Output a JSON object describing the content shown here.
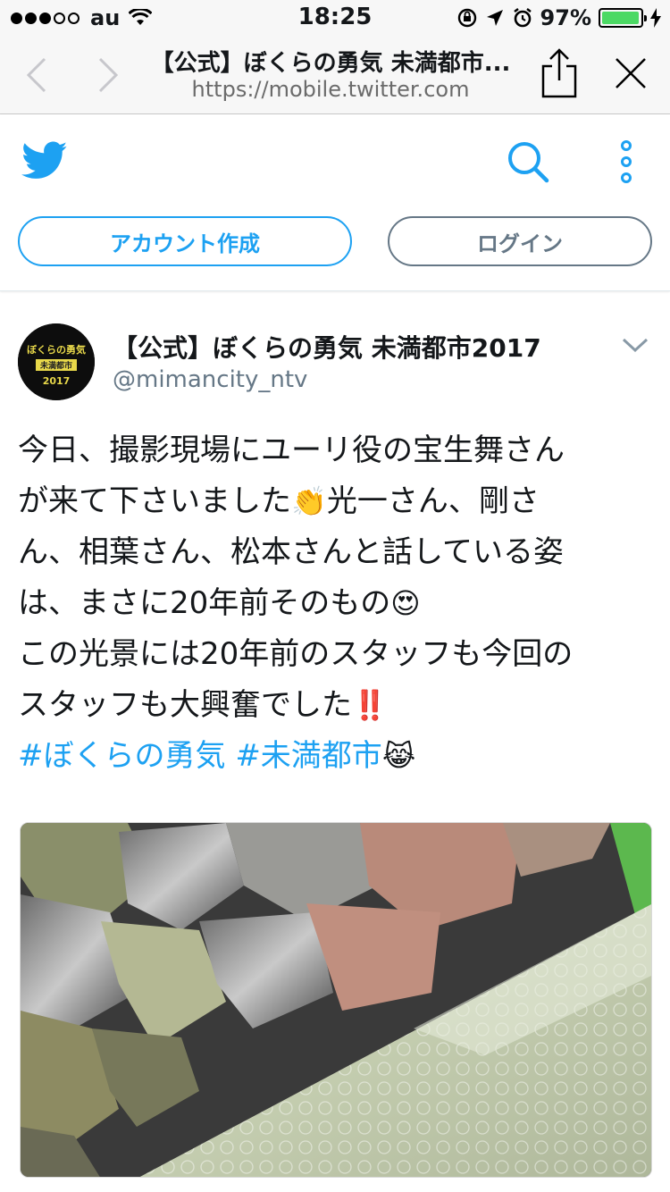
{
  "status_bar": {
    "carrier": "au",
    "time": "18:25",
    "battery_percent": "97%",
    "battery_level": 0.97
  },
  "browser": {
    "title": "【公式】ぼくらの勇気 未満都市...",
    "url": "https://mobile.twitter.com"
  },
  "header": {
    "signup_label": "アカウント作成",
    "login_label": "ログイン"
  },
  "tweet": {
    "display_name": "【公式】ぼくらの勇気 未満都市2017",
    "handle": "@mimancity_ntv",
    "avatar_text": [
      "ぼくらの勇気",
      "未満都市",
      "2017"
    ],
    "lines": [
      "今日、撮影現場にユーリ役の宝生舞さん",
      "が来て下さいました",
      "光一さん、剛さ",
      "ん、相葉さん、松本さんと話している姿",
      "は、まさに20年前そのもの",
      "この光景には20年前のスタッフも今回の",
      "スタッフも大興奮でした"
    ],
    "hashtags": [
      "#ぼくらの勇気",
      "#未満都市"
    ],
    "emoji": {
      "clap": "👏",
      "heart_eyes": "😍",
      "exclamation": "‼️",
      "cat": "😹"
    }
  },
  "colors": {
    "twitter_blue": "#1da1f2",
    "grey_text": "#657786",
    "battery_green": "#4cd964"
  }
}
